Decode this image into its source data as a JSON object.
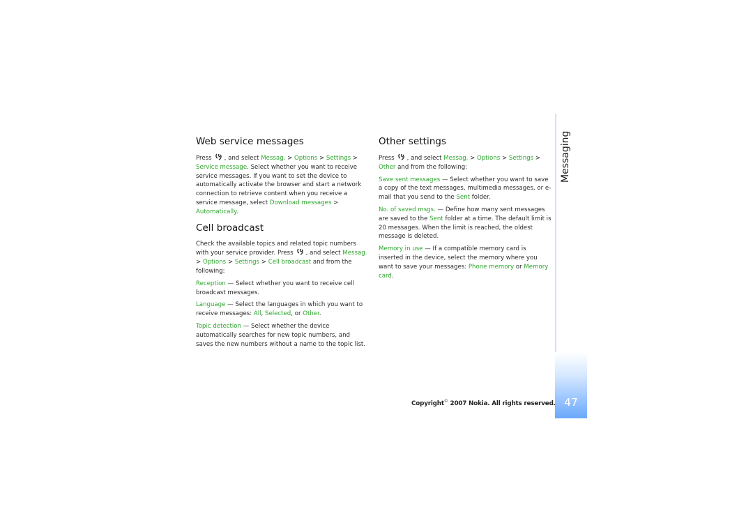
{
  "chapter": "Messaging",
  "page_number": "47",
  "footer": {
    "copyright_prefix": "Copyright",
    "copyright_symbol": "©",
    "copyright_text": "2007 Nokia. All rights reserved."
  },
  "accent_color": "#2fa52f",
  "sections": {
    "web_service": {
      "title": "Web service messages",
      "p1": {
        "t1": "Press",
        "icon": "menu-key-icon",
        "t2": ", and select",
        "l1": "Messag.",
        "t3": ">",
        "l2": "Options",
        "t4": ">",
        "l3": "Settings",
        "t5": ">",
        "l4": "Service message",
        "t6": ". Select whether you want to receive service messages. If you want to set the device to automatically activate the browser and start a network connection to retrieve content when you receive a service message, select",
        "l5": "Download messages",
        "t7": ">",
        "l6": "Automatically",
        "t8": "."
      }
    },
    "cell_broadcast": {
      "title": "Cell broadcast",
      "p1": {
        "t1": "Check the available topics and related topic numbers with your service provider. Press",
        "t2": ", and select",
        "l1": "Messag.",
        "t3": ">",
        "l2": "Options",
        "t4": ">",
        "l3": "Settings",
        "t5": ">",
        "l4": "Cell broadcast",
        "t6": "and from the following:"
      },
      "reception": {
        "label": "Reception",
        "text": "— Select whether you want to receive cell broadcast messages."
      },
      "language": {
        "label": "Language",
        "text": "— Select the languages in which you want to receive messages:",
        "o1": "All",
        "sep1": ",",
        "o2": "Selected",
        "sep2": ", or",
        "o3": "Other",
        "end": "."
      },
      "topic": {
        "label": "Topic detection",
        "text": "— Select whether the device automatically searches for new topic numbers, and saves the new numbers without a name to the topic list."
      }
    },
    "other_settings": {
      "title": "Other settings",
      "p1": {
        "t1": "Press",
        "t2": ", and select",
        "l1": "Messag.",
        "t3": ">",
        "l2": "Options",
        "t4": ">",
        "l3": "Settings",
        "t5": ">",
        "l4": "Other",
        "t6": "and from the following:"
      },
      "save_sent": {
        "label": "Save sent messages",
        "text": "— Select whether you want to save a copy of the text messages, multimedia messages, or e-mail that you send to the",
        "l1": "Sent",
        "end": "folder."
      },
      "saved_msgs": {
        "label": "No. of saved msgs.",
        "text": "— Define how many sent messages are saved to the",
        "l1": "Sent",
        "end": "folder at a time. The default limit is 20 messages. When the limit is reached, the oldest message is deleted."
      },
      "memory": {
        "label": "Memory in use",
        "text": "— If a compatible memory card is inserted in the device, select the memory where you want to save your messages:",
        "o1": "Phone memory",
        "sep": "or",
        "o2": "Memory card",
        "end": "."
      }
    }
  }
}
